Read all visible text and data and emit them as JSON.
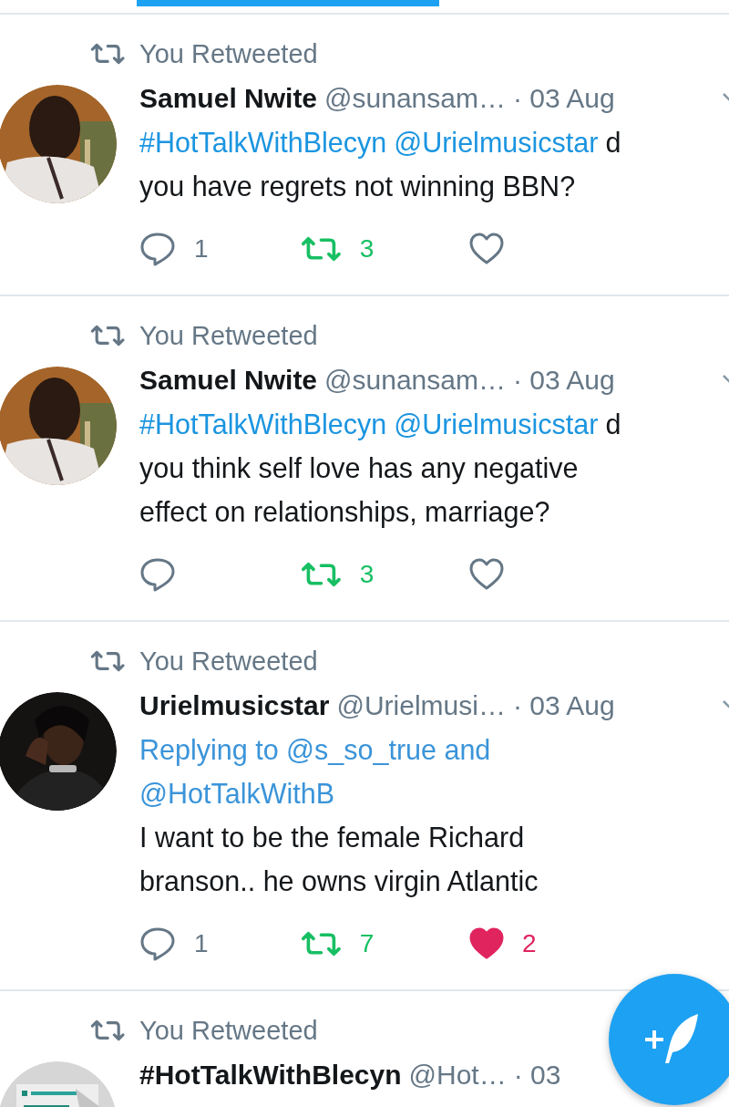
{
  "tweets": [
    {
      "retweet_label": "You Retweeted",
      "avatar": {
        "kind": "picture"
      },
      "name": "Samuel Nwite",
      "handle": "@sunansam…",
      "time": "· 03 Aug",
      "body_lines": [
        [
          {
            "kind": "link",
            "text": "#HotTalkWithBlecyn"
          },
          {
            "kind": "link",
            "text": "@Urielmusicstar"
          },
          {
            "kind": "text",
            "text": "d"
          }
        ],
        [
          {
            "kind": "text",
            "text": "you have regrets not winning BBN?"
          }
        ]
      ],
      "reply_count": "1",
      "retweet_count": "3",
      "retweeted": true,
      "liked": false
    },
    {
      "retweet_label": "You Retweeted",
      "avatar": {
        "kind": "picture"
      },
      "name": "Samuel Nwite",
      "handle": "@sunansam…",
      "time": "· 03 Aug",
      "body_lines": [
        [
          {
            "kind": "link",
            "text": "#HotTalkWithBlecyn"
          },
          {
            "kind": "link",
            "text": "@Urielmusicstar"
          },
          {
            "kind": "text",
            "text": "d"
          }
        ],
        [
          {
            "kind": "text",
            "text": "you think self love has any negative"
          }
        ],
        [
          {
            "kind": "text",
            "text": "effect on relationships, marriage?"
          }
        ]
      ],
      "retweet_count": "3",
      "retweeted": true,
      "liked": false
    },
    {
      "retweet_label": "You Retweeted",
      "avatar": {
        "kind": "picture"
      },
      "name": "Urielmusicstar",
      "handle": "@Urielmusi…",
      "time": "· 03 Aug",
      "reply_to": [
        "Replying to @s_so_true and",
        "@HotTalkWithB"
      ],
      "body_lines": [
        [
          {
            "kind": "text",
            "text": "I want to be the female Richard"
          }
        ],
        [
          {
            "kind": "text",
            "text": "branson.. he owns virgin Atlantic"
          }
        ]
      ],
      "reply_count": "1",
      "retweet_count": "7",
      "retweeted": true,
      "like_count": "2",
      "liked": true
    },
    {
      "retweet_label": "You Retweeted",
      "avatar": {
        "kind": "picture"
      },
      "name": "#HotTalkWithBlecyn",
      "handle": "@Hot…",
      "time": "· 03"
    }
  ]
}
